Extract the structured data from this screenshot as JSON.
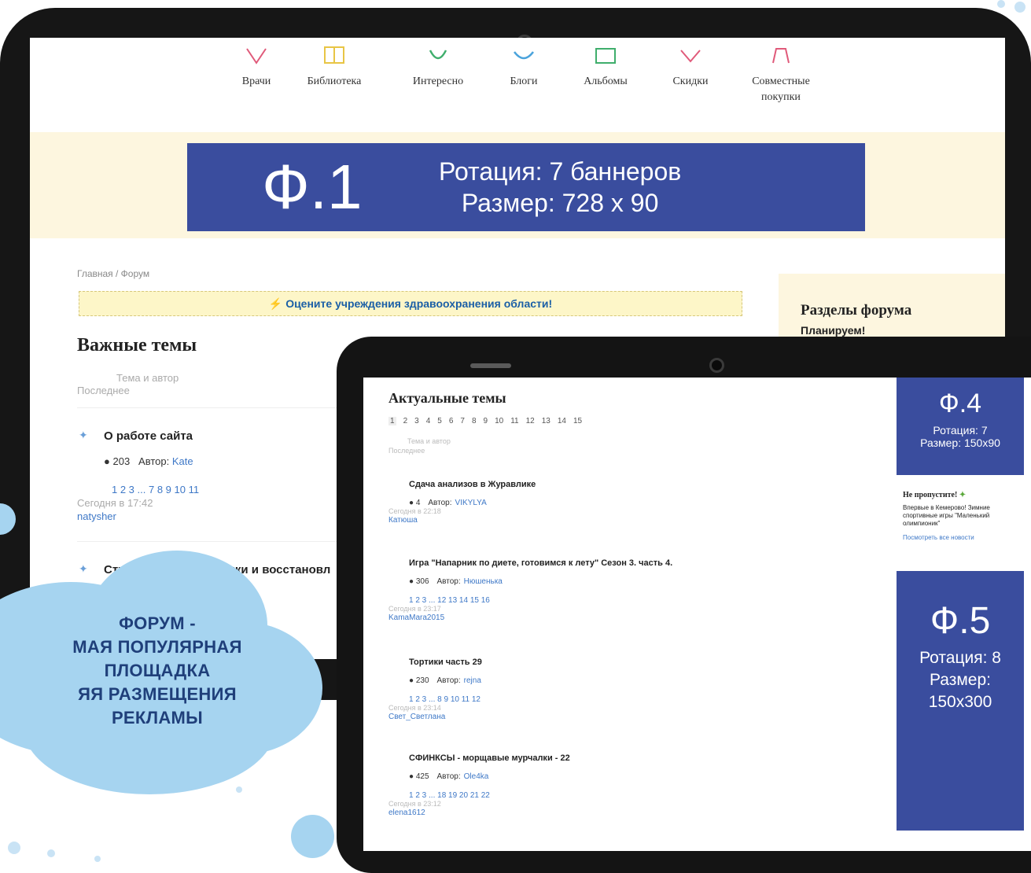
{
  "nav": {
    "items": [
      {
        "label": "Врачи",
        "icon": "stethoscope-icon"
      },
      {
        "label": "Библиотека",
        "icon": "book-icon"
      },
      {
        "label": "Интересно",
        "icon": "smile-icon"
      },
      {
        "label": "Блоги",
        "icon": "chat-icon"
      },
      {
        "label": "Альбомы",
        "icon": "photo-icon"
      },
      {
        "label": "Скидки",
        "icon": "tag-icon"
      },
      {
        "label": "Совместные покупки",
        "icon": "bag-icon"
      }
    ]
  },
  "banner_f1": {
    "code": "Ф.1",
    "line1": "Ротация: 7 баннеров",
    "line2": "Размер: 728 x 90"
  },
  "breadcrumb": "Главная / Форум",
  "alert": {
    "icon": "lightning-icon",
    "text": "Оцените учреждения здравоохранения области!"
  },
  "important": {
    "title": "Важные темы",
    "col_topic": "Тема и автор",
    "col_last": "Последнее",
    "topic1": {
      "title": "О работе сайта",
      "count": "203",
      "author_label": "Автор:",
      "author": "Kate",
      "pages": "1 2 3 ... 7 8 9 10 11",
      "last_time": "Сегодня в 17:42",
      "last_user": "natysher"
    },
    "topic2_fragment_a": "Сту",
    "topic2_fragment_b": "стики и восстановл"
  },
  "sidebar": {
    "title": "Разделы форума",
    "item": "Планируем!"
  },
  "cloud": {
    "line1": "ФОРУМ -",
    "line2": "МАЯ ПОПУЛЯРНАЯ",
    "line3": "ПЛОЩАДКА",
    "line4": "ЯЯ РАЗМЕЩЕНИЯ",
    "line5": "РЕКЛАМЫ"
  },
  "tablet": {
    "title": "Актуальные темы",
    "pagination": [
      "1",
      "2",
      "3",
      "4",
      "5",
      "6",
      "7",
      "8",
      "9",
      "10",
      "11",
      "12",
      "13",
      "14",
      "15"
    ],
    "col_topic": "Тема и автор",
    "col_last": "Последнее",
    "topics": [
      {
        "title": "Сдача анализов в Журавлике",
        "count": "4",
        "author_label": "Автор:",
        "author": "VIKYLYA",
        "pages": "",
        "last_time": "Сегодня в 22:18",
        "last_user": "Катюша"
      },
      {
        "title": "Игра \"Напарник по диете, готовимся к лету\" Сезон 3. часть 4.",
        "count": "306",
        "author_label": "Автор:",
        "author": "Нюшенька",
        "pages": "1 2 3 ... 12 13 14 15 16",
        "last_time": "Сегодня в 23:17",
        "last_user": "KamaMara2015"
      },
      {
        "title": "Тортики часть 29",
        "count": "230",
        "author_label": "Автор:",
        "author": "rejna",
        "pages": "1 2 3 ... 8 9 10 11 12",
        "last_time": "Сегодня в 23:14",
        "last_user": "Свет_Светлана"
      },
      {
        "title": "СФИНКСЫ - морщавые мурчалки - 22",
        "count": "425",
        "author_label": "Автор:",
        "author": "Ole4ka",
        "pages": "1 2 3 ... 18 19 20 21 22",
        "last_time": "Сегодня в 23:12",
        "last_user": "elena1612"
      }
    ],
    "banner_f4": {
      "code": "Ф.4",
      "line1": "Ротация: 7",
      "line2": "Размер: 150x90"
    },
    "news": {
      "title": "Не пропустите!",
      "text": "Впервые в Кемерово! Зимние спортивные игры \"Маленький олимпионик\"",
      "link": "Посмотреть все новости"
    },
    "banner_f5": {
      "code": "Ф.5",
      "line1": "Ротация: 8",
      "line2": "Размер:",
      "line3": "150x300"
    }
  },
  "colors": {
    "banner": "#3a4d9e",
    "cloud": "#a6d4f0",
    "cloud_text": "#1f3f7a",
    "link": "#3e78c7",
    "band": "#fdf6df"
  }
}
